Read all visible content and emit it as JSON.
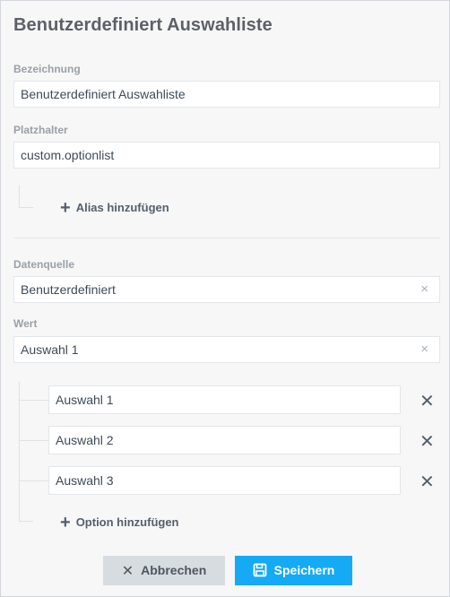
{
  "dialog": {
    "title": "Benutzerdefiniert Auswahliste"
  },
  "bezeichnung": {
    "label": "Bezeichnung",
    "value": "Benutzerdefiniert Auswahliste"
  },
  "platzhalter": {
    "label": "Platzhalter",
    "value": "custom.optionlist"
  },
  "alias": {
    "add_label": "Alias hinzufügen"
  },
  "datenquelle": {
    "label": "Datenquelle",
    "value": "Benutzerdefiniert",
    "clear_glyph": "×"
  },
  "wert": {
    "label": "Wert",
    "value": "Auswahl 1",
    "clear_glyph": "×"
  },
  "options": [
    {
      "value": "Auswahl 1"
    },
    {
      "value": "Auswahl 2"
    },
    {
      "value": "Auswahl 3"
    }
  ],
  "add_option_label": "Option hinzufügen",
  "icons": {
    "plus": "+",
    "remove": "✕"
  },
  "buttons": {
    "cancel_label": "Abbrechen",
    "save_label": "Speichern"
  },
  "colors": {
    "save_bg": "#14aaf5",
    "cancel_bg": "#d7dce1"
  }
}
